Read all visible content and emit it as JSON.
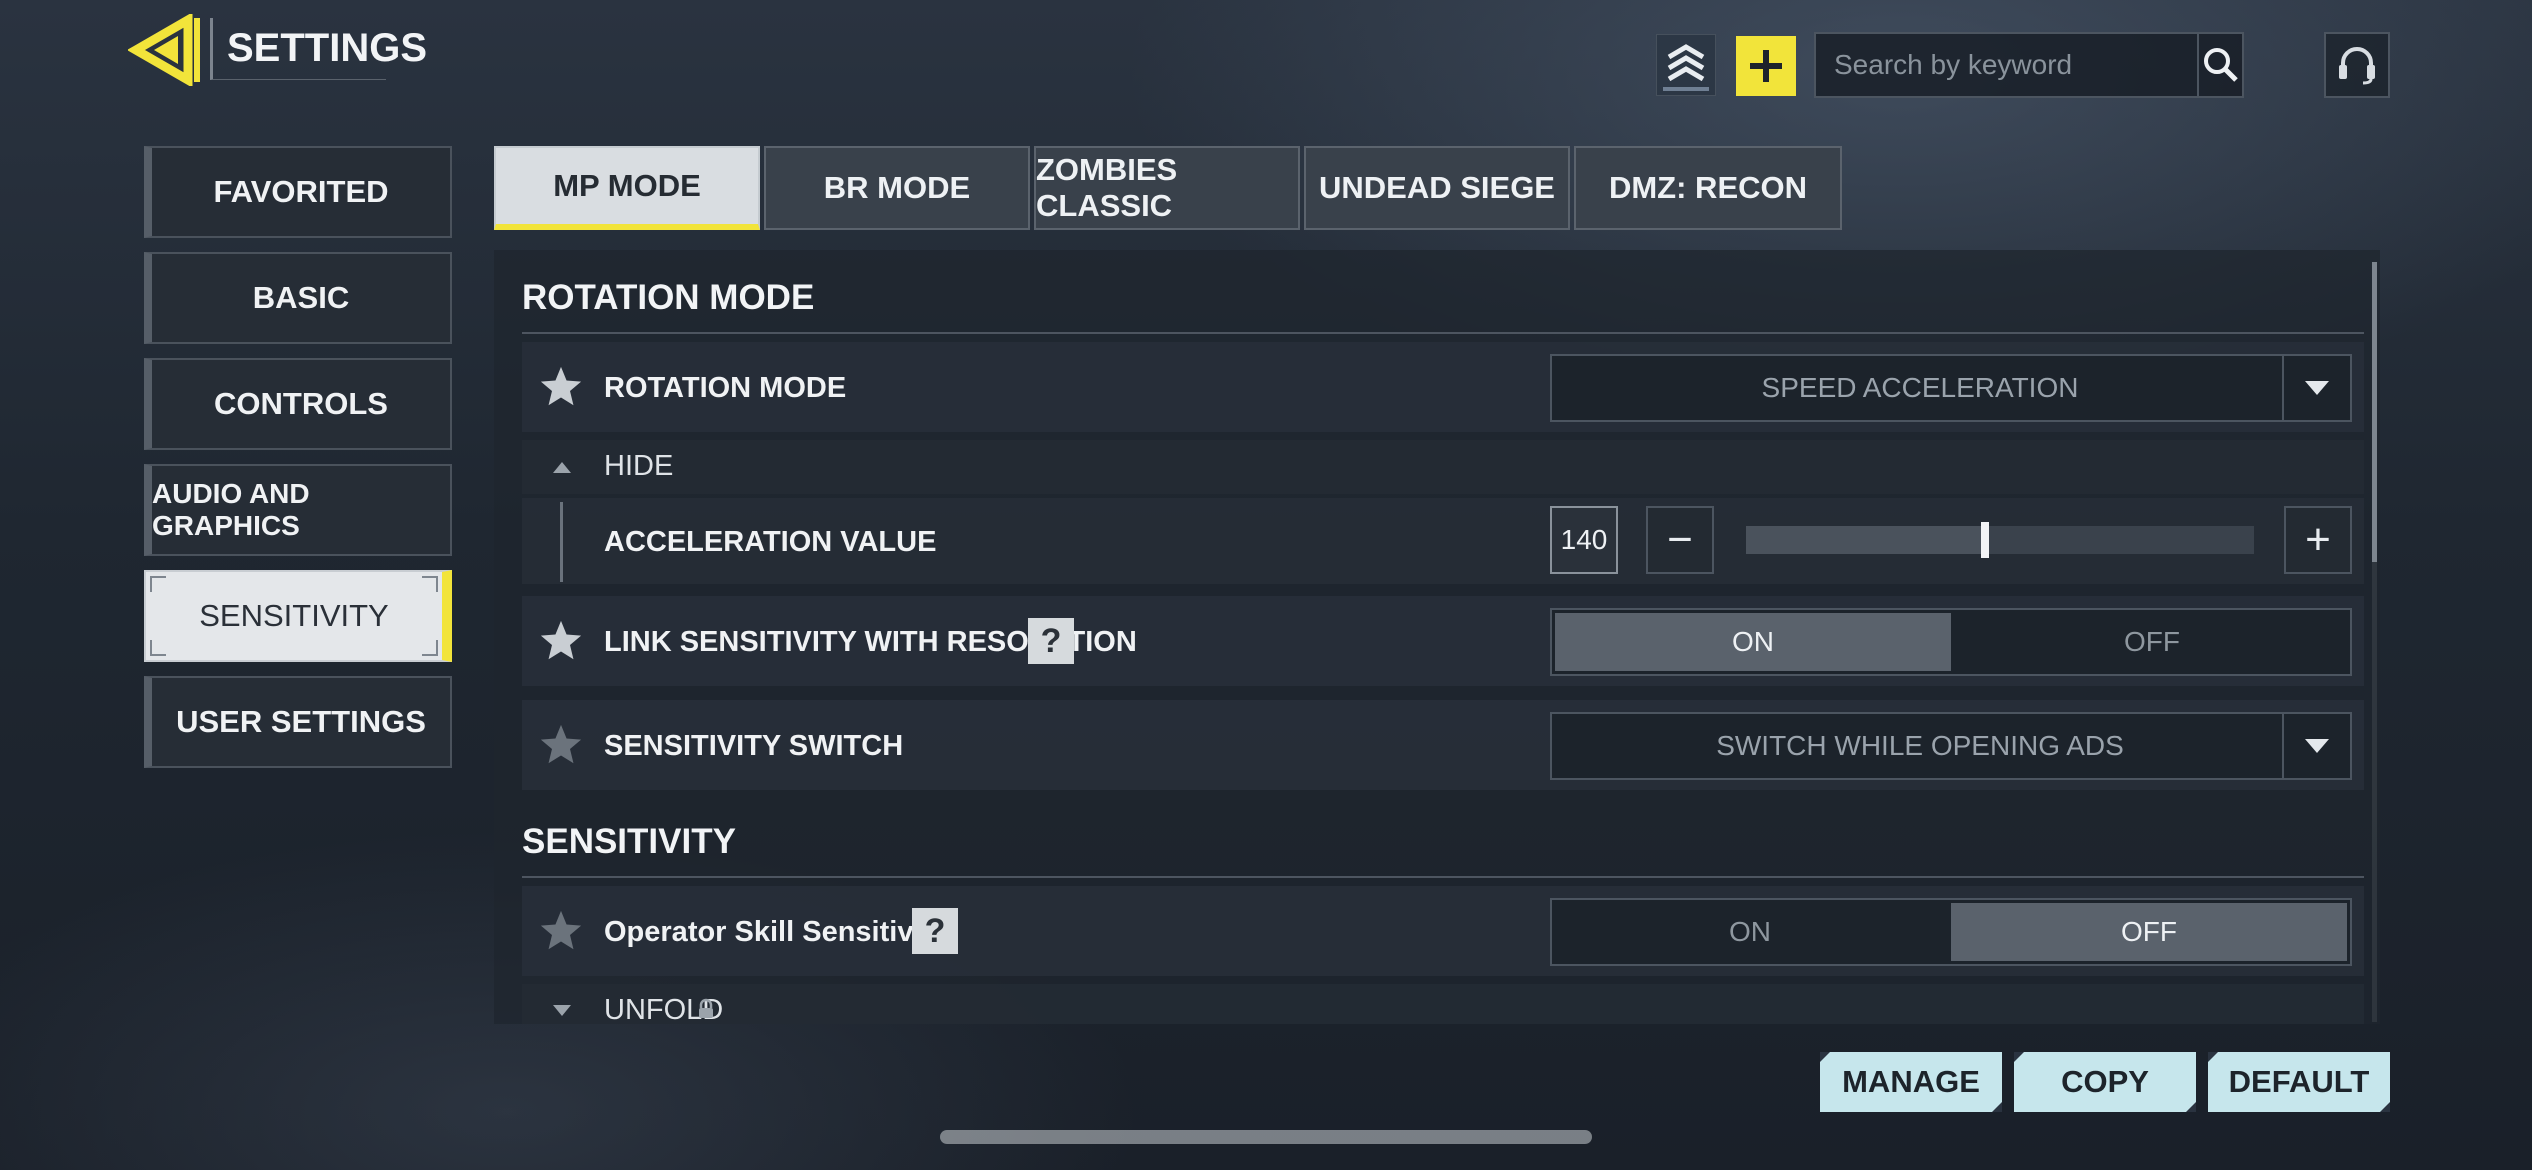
{
  "header": {
    "title": "SETTINGS",
    "search_placeholder": "Search by keyword",
    "accent_color": "#f2e43a"
  },
  "icons": {
    "back": "back-arrow-icon",
    "rank": "rank-chevron-icon",
    "add": "plus-icon",
    "search": "search-icon",
    "support": "headset-icon",
    "favorite": "star-icon",
    "help": "question-icon",
    "lock": "lock-icon"
  },
  "sidebar": {
    "items": [
      {
        "label": "FAVORITED",
        "active": false
      },
      {
        "label": "BASIC",
        "active": false
      },
      {
        "label": "CONTROLS",
        "active": false
      },
      {
        "label": "AUDIO AND GRAPHICS",
        "active": false
      },
      {
        "label": "SENSITIVITY",
        "active": true
      },
      {
        "label": "USER SETTINGS",
        "active": false
      }
    ]
  },
  "tabs": [
    {
      "label": "MP MODE",
      "active": true
    },
    {
      "label": "BR MODE",
      "active": false
    },
    {
      "label": "ZOMBIES CLASSIC",
      "active": false
    },
    {
      "label": "UNDEAD SIEGE",
      "active": false
    },
    {
      "label": "DMZ: RECON",
      "active": false
    }
  ],
  "sections": {
    "rotation": {
      "title": "ROTATION MODE",
      "rotation_mode": {
        "label": "ROTATION MODE",
        "value": "SPEED ACCELERATION"
      },
      "hide_label": "HIDE",
      "acceleration": {
        "label": "ACCELERATION VALUE",
        "value": "140",
        "minus": "−",
        "plus": "+",
        "level": 0.47
      },
      "link_sensitivity": {
        "label": "LINK SENSITIVITY WITH RESOLUTION",
        "on": "ON",
        "off": "OFF",
        "selected": "ON"
      },
      "sensitivity_switch": {
        "label": "SENSITIVITY SWITCH",
        "value": "SWITCH WHILE OPENING ADS"
      }
    },
    "sensitivity": {
      "title": "SENSITIVITY",
      "operator_skill": {
        "label": "Operator Skill Sensitivity",
        "on": "ON",
        "off": "OFF",
        "selected": "OFF"
      },
      "unfold_label": "UNFOLD"
    }
  },
  "help_glyph": "?",
  "footer": {
    "manage": "MANAGE",
    "copy": "COPY",
    "default": "DEFAULT"
  }
}
